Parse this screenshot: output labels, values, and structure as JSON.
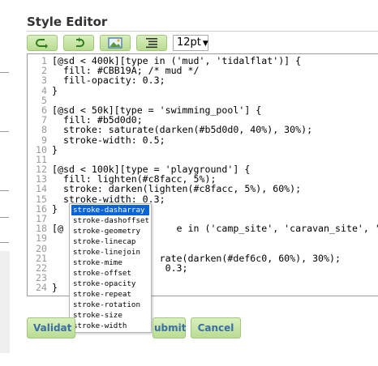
{
  "page": {
    "title": "Style Editor"
  },
  "toolbar": {
    "buttons": [
      {
        "name": "undo",
        "icon": "undo-arrow-icon"
      },
      {
        "name": "redo",
        "icon": "redo-arrow-icon"
      },
      {
        "name": "image",
        "icon": "image-icon"
      },
      {
        "name": "indent",
        "icon": "list-indent-icon"
      }
    ],
    "font_size": "12pt",
    "font_size_arrow": "▼"
  },
  "editor": {
    "lines": [
      {
        "n": "1",
        "text": "[@sd < 400k][type in ('mud', 'tidalflat')] {"
      },
      {
        "n": "2",
        "text": "  fill: #CBB19A; /* mud */"
      },
      {
        "n": "3",
        "text": "  fill-opacity: 0.3;"
      },
      {
        "n": "4",
        "text": "}"
      },
      {
        "n": "5",
        "text": ""
      },
      {
        "n": "6",
        "text": "[@sd < 50k][type = 'swimming_pool'] {"
      },
      {
        "n": "7",
        "text": "  fill: #b5d0d0;"
      },
      {
        "n": "8",
        "text": "  stroke: saturate(darken(#b5d0d0, 40%), 30%);"
      },
      {
        "n": "9",
        "text": "  stroke-width: 0.5;"
      },
      {
        "n": "10",
        "text": "}"
      },
      {
        "n": "11",
        "text": ""
      },
      {
        "n": "12",
        "text": "[@sd < 100k][type = 'playground'] {"
      },
      {
        "n": "13",
        "text": "  fill: lighten(#c8facc, 5%);"
      },
      {
        "n": "14",
        "text": "  stroke: darken(lighten(#c8facc, 5%), 60%);"
      },
      {
        "n": "15",
        "text": "  stroke-width: 0.3;"
      },
      {
        "n": "16",
        "text": "}"
      },
      {
        "n": "17",
        "text": ""
      },
      {
        "n": "18",
        "text": "[@                    e in ('camp_site', 'caravan_site', 'pic"
      },
      {
        "n": "19",
        "text": ""
      },
      {
        "n": "20",
        "text": ""
      },
      {
        "n": "21",
        "text": "                   rate(darken(#def6c0, 60%), 30%);"
      },
      {
        "n": "22",
        "text": "                    0.3;"
      },
      {
        "n": "23",
        "text": ""
      },
      {
        "n": "24",
        "text": "}"
      }
    ]
  },
  "autocomplete": {
    "items": [
      "stroke-dasharray",
      "stroke-dashoffset",
      "stroke-geometry",
      "stroke-linecap",
      "stroke-linejoin",
      "stroke-mime",
      "stroke-offset",
      "stroke-opacity",
      "stroke-repeat",
      "stroke-rotation",
      "stroke-size",
      "stroke-width"
    ],
    "selected_index": 0
  },
  "actions": {
    "validate": "Validat",
    "submit": "ubmit",
    "cancel": "Cancel"
  },
  "colors": {
    "button_fill": "#c6e6a4",
    "button_text": "#3a6ea5",
    "selection": "#0a64d6"
  }
}
